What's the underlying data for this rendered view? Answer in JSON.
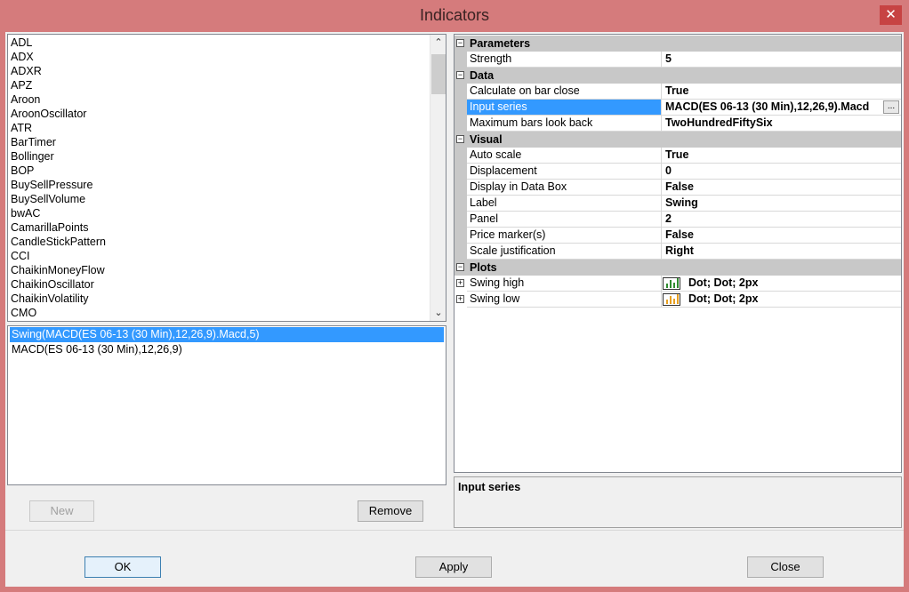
{
  "window": {
    "title": "Indicators",
    "close_glyph": "✕"
  },
  "indicator_list": {
    "items": [
      "ADL",
      "ADX",
      "ADXR",
      "APZ",
      "Aroon",
      "AroonOscillator",
      "ATR",
      "BarTimer",
      "Bollinger",
      "BOP",
      "BuySellPressure",
      "BuySellVolume",
      "bwAC",
      "CamarillaPoints",
      "CandleStickPattern",
      "CCI",
      "ChaikinMoneyFlow",
      "ChaikinOscillator",
      "ChaikinVolatility",
      "CMO"
    ],
    "scroll_up": "⌃",
    "scroll_down": "⌄"
  },
  "applied_list": {
    "items": [
      "Swing(MACD(ES 06-13 (30 Min),12,26,9).Macd,5)",
      "MACD(ES 06-13 (30 Min),12,26,9)"
    ],
    "selected_index": 0
  },
  "left_buttons": {
    "new": "New",
    "remove": "Remove"
  },
  "property_grid": {
    "categories": {
      "parameters": "Parameters",
      "data": "Data",
      "visual": "Visual",
      "plots": "Plots"
    },
    "collapse_glyph": "−",
    "expand_glyph": "+",
    "parameters": [
      {
        "name": "Strength",
        "value": "5"
      }
    ],
    "data": [
      {
        "name": "Calculate on bar close",
        "value": "True"
      },
      {
        "name": "Input series",
        "value": "MACD(ES 06-13 (30 Min),12,26,9).Macd"
      },
      {
        "name": "Maximum bars look back",
        "value": "TwoHundredFiftySix"
      }
    ],
    "visual": [
      {
        "name": "Auto scale",
        "value": "True"
      },
      {
        "name": "Displacement",
        "value": "0"
      },
      {
        "name": "Display in Data Box",
        "value": "False"
      },
      {
        "name": "Label",
        "value": "Swing"
      },
      {
        "name": "Panel",
        "value": "2"
      },
      {
        "name": "Price marker(s)",
        "value": "False"
      },
      {
        "name": "Scale justification",
        "value": "Right"
      }
    ],
    "plots": [
      {
        "name": "Swing high",
        "value": "Dot; Dot; 2px",
        "color": "#2e8b2e"
      },
      {
        "name": "Swing low",
        "value": "Dot; Dot; 2px",
        "color": "#e8a020"
      }
    ],
    "ellipsis": "..."
  },
  "description": {
    "title": "Input series"
  },
  "dialog_buttons": {
    "ok": "OK",
    "apply": "Apply",
    "close": "Close"
  }
}
